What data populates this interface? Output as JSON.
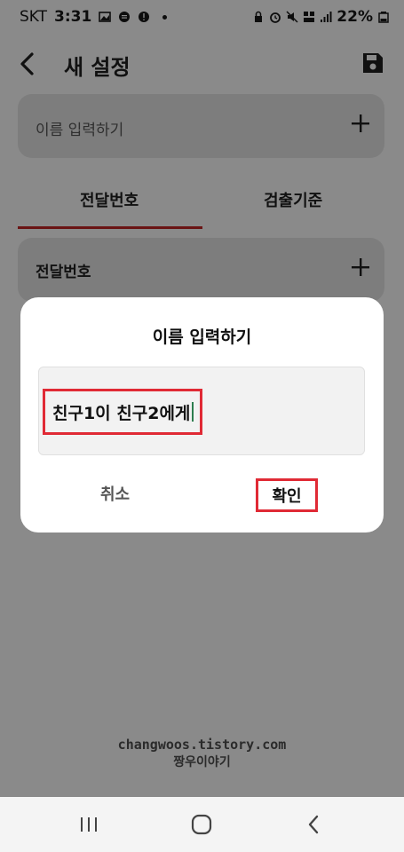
{
  "status_bar": {
    "carrier": "SKT",
    "time": "3:31",
    "battery": "22%"
  },
  "header": {
    "title": "새 설정"
  },
  "name_card": {
    "label": "이름 입력하기"
  },
  "tabs": [
    {
      "label": "전달번호",
      "selected": true
    },
    {
      "label": "검출기준",
      "selected": false
    }
  ],
  "relay_card": {
    "label": "전달번호"
  },
  "dialog": {
    "title": "이름 입력하기",
    "input_value": "친구1이 친구2에게",
    "cancel_label": "취소",
    "confirm_label": "확인"
  },
  "watermark": {
    "line1": "changwoos.tistory.com",
    "line2": "짱우이야기"
  },
  "colors": {
    "highlight": "#e02a35",
    "tab_indicator": "#6a1414",
    "scrim": "#8a8a8a"
  }
}
